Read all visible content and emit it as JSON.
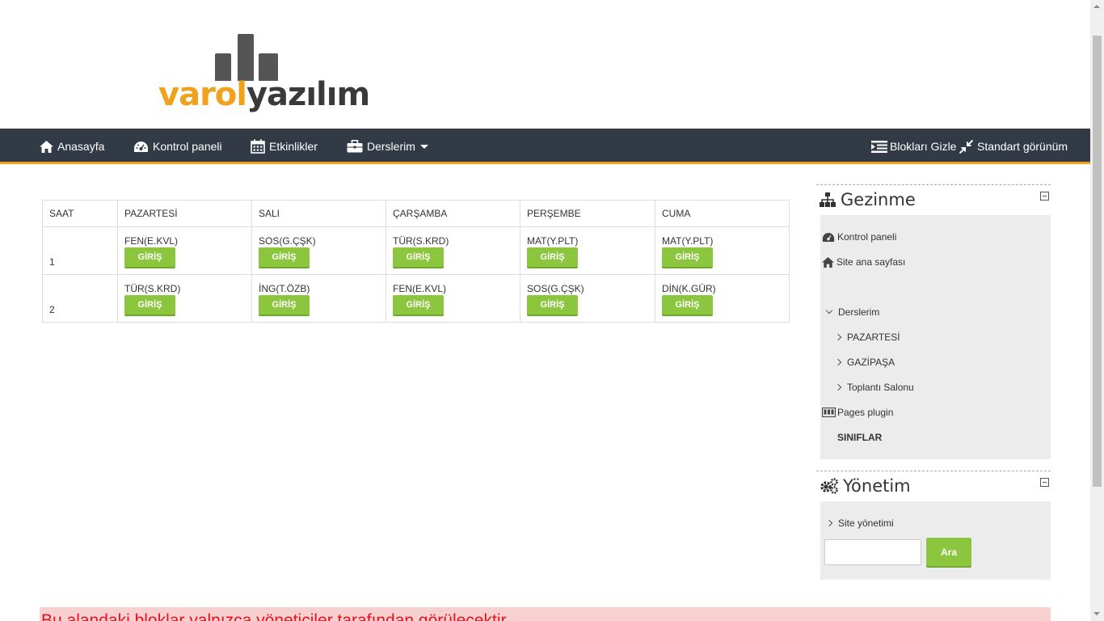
{
  "logo": {
    "part1": "varol",
    "part2": "yazılım"
  },
  "nav": {
    "home": "Anasayfa",
    "dashboard": "Kontrol paneli",
    "events": "Etkinlikler",
    "courses": "Derslerim",
    "hide_blocks": "Blokları Gizle",
    "standard_view": "Standart görünüm"
  },
  "schedule": {
    "headers": [
      "SAAT",
      "PAZARTESİ",
      "SALI",
      "ÇARŞAMBA",
      "PERŞEMBE",
      "CUMA"
    ],
    "button_label": "GİRİŞ",
    "rows": [
      {
        "saat": "1",
        "lessons": [
          "FEN(E.KVL)",
          "SOS(G.ÇŞK)",
          "TÜR(S.KRD)",
          "MAT(Y.PLT)",
          "MAT(Y.PLT)"
        ]
      },
      {
        "saat": "2",
        "lessons": [
          "TÜR(S.KRD)",
          "İNG(T.ÖZB)",
          "FEN(E.KVL)",
          "SOS(G.ÇŞK)",
          "DİN(K.GÜR)"
        ]
      }
    ]
  },
  "navigation_block": {
    "title": "Gezinme",
    "dashboard": "Kontrol paneli",
    "site_home": "Site ana sayfası",
    "my_courses": "Derslerim",
    "course_items": [
      "PAZARTESİ",
      "GAZİPAŞA",
      "Toplantı Salonu"
    ],
    "pages_plugin": "Pages plugin",
    "classes": "SINIFLAR"
  },
  "admin_block": {
    "title": "Yönetim",
    "site_admin": "Site yönetimi",
    "search_button": "Ara",
    "search_value": ""
  },
  "alert": "Bu alandaki bloklar yalnızca yöneticiler tarafından görülecektir"
}
